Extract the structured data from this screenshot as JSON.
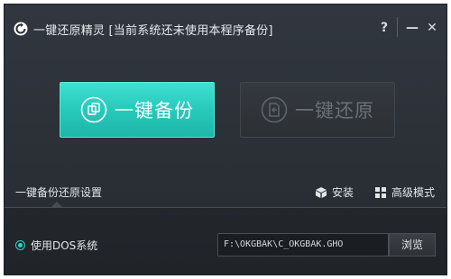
{
  "titlebar": {
    "app_icon": "refresh-circle-icon",
    "title": "一键还原精灵 [当前系统还未使用本程序备份]",
    "help_label": "?",
    "minimize_label": "—",
    "close_label": "✕"
  },
  "main": {
    "backup_button": {
      "label": "一键备份",
      "icon": "copy-icon",
      "enabled": true
    },
    "restore_button": {
      "label": "一键还原",
      "icon": "restore-document-icon",
      "enabled": false
    }
  },
  "settings": {
    "title": "一键备份还原设置",
    "install_label": "安装",
    "install_icon": "install-box-icon",
    "advanced_label": "高级模式",
    "advanced_icon": "grid-icon"
  },
  "dos_option": {
    "label": "使用DOS系统",
    "selected": true
  },
  "path": {
    "value": "F:\\OKGBAK\\C_OKGBAK.GHO"
  },
  "browse": {
    "label": "浏览"
  },
  "colors": {
    "accent": "#2ed3c5",
    "background": "#2b3037",
    "disabled_text": "#6a7077"
  }
}
